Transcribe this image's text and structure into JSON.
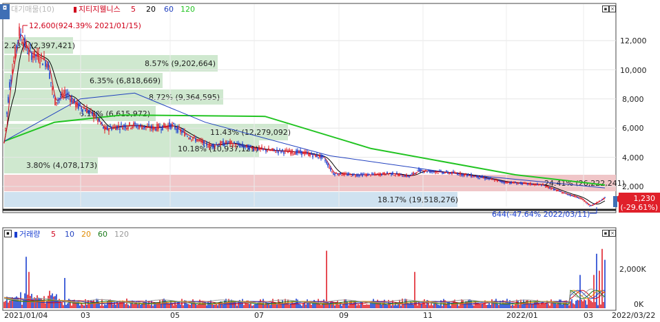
{
  "price_panel": {
    "legend": {
      "prefix": "▮",
      "name": "지티지웰니스",
      "ma_labels": [
        "5",
        "20",
        "60",
        "120"
      ],
      "ma_colors": [
        "#d0021b",
        "#000000",
        "#1f3fbf",
        "#22c422"
      ],
      "ghost_text": "대기매물(10)"
    },
    "y_ticks": [
      "12,000",
      "10,000",
      "8,000",
      "6,000",
      "4,000",
      "2,000"
    ],
    "current_price": "1,230",
    "current_change": "(-29.61%)",
    "high_annotation": "12,600(924.39% 2021/01/15)",
    "low_annotation": "644(-47.64% 2022/03/11)",
    "volume_profile": [
      {
        "label": "2.23%  (2,397,421)"
      },
      {
        "label": "8.57%  (9,202,664)"
      },
      {
        "label": "6.35%  (6,818,669)"
      },
      {
        "label": "8.72%  (9,364,595)"
      },
      {
        "label": "6.15%  (6,615,972)"
      },
      {
        "label": "11.43%  (12,279,092)"
      },
      {
        "label": "10.18%  (10,937,121)"
      },
      {
        "label": "3.80%  (4,078,173)"
      },
      {
        "label": "24.41%  (26,222,241)"
      },
      {
        "label": "18.17%  (19,518,276)"
      }
    ]
  },
  "volume_panel": {
    "legend": {
      "prefix": "▮",
      "name": "거래량",
      "ma_labels": [
        "5",
        "10",
        "20",
        "60",
        "120"
      ],
      "ma_colors": [
        "#d0021b",
        "#1f3fbf",
        "#e08a00",
        "#1a7a1a",
        "#999999"
      ]
    },
    "y_ticks": [
      "2,000K",
      "0K"
    ]
  },
  "x_axis": {
    "labels": [
      "2021/01/04",
      "03",
      "05",
      "07",
      "09",
      "11",
      "2022/01",
      "03",
      "2022/03/22"
    ]
  },
  "colors": {
    "up": "#e0202a",
    "down": "#1a3fd0",
    "profile_green": "#cfe8cf",
    "profile_red": "#f0c6c8",
    "profile_blue": "#cfe2f0",
    "price_tag_bg": "#e0202a"
  },
  "chart_data": {
    "type": "candlestick",
    "title": "지티지웰니스",
    "x_range": [
      "2021/01/04",
      "2022/03/22"
    ],
    "ylim": [
      644,
      12600
    ],
    "price_points": [
      {
        "date": "2021/01/04",
        "price": 5000
      },
      {
        "date": "2021/01/08",
        "price": 9000
      },
      {
        "date": "2021/01/15",
        "price": 12600
      },
      {
        "date": "2021/01/22",
        "price": 11200
      },
      {
        "date": "2021/01/29",
        "price": 10900
      },
      {
        "date": "2021/02/05",
        "price": 10500
      },
      {
        "date": "2021/02/10",
        "price": 7800
      },
      {
        "date": "2021/02/19",
        "price": 8400
      },
      {
        "date": "2021/02/26",
        "price": 7600
      },
      {
        "date": "2021/03/05",
        "price": 7300
      },
      {
        "date": "2021/03/12",
        "price": 6800
      },
      {
        "date": "2021/03/19",
        "price": 5900
      },
      {
        "date": "2021/03/26",
        "price": 6100
      },
      {
        "date": "2021/04/09",
        "price": 6200
      },
      {
        "date": "2021/04/23",
        "price": 6000
      },
      {
        "date": "2021/05/07",
        "price": 6200
      },
      {
        "date": "2021/05/21",
        "price": 5400
      },
      {
        "date": "2021/06/04",
        "price": 4800
      },
      {
        "date": "2021/06/18",
        "price": 5000
      },
      {
        "date": "2021/07/02",
        "price": 4700
      },
      {
        "date": "2021/07/16",
        "price": 4500
      },
      {
        "date": "2021/07/30",
        "price": 4400
      },
      {
        "date": "2021/08/13",
        "price": 4300
      },
      {
        "date": "2021/08/27",
        "price": 4000
      },
      {
        "date": "2021/09/03",
        "price": 2900
      },
      {
        "date": "2021/09/17",
        "price": 2800
      },
      {
        "date": "2021/10/01",
        "price": 2800
      },
      {
        "date": "2021/10/15",
        "price": 2900
      },
      {
        "date": "2021/10/29",
        "price": 2700
      },
      {
        "date": "2021/11/05",
        "price": 3100
      },
      {
        "date": "2021/11/19",
        "price": 3000
      },
      {
        "date": "2021/12/03",
        "price": 2900
      },
      {
        "date": "2021/12/17",
        "price": 2700
      },
      {
        "date": "2022/01/07",
        "price": 2300
      },
      {
        "date": "2022/01/21",
        "price": 2200
      },
      {
        "date": "2022/02/04",
        "price": 2100
      },
      {
        "date": "2022/02/18",
        "price": 1600
      },
      {
        "date": "2022/03/04",
        "price": 1200
      },
      {
        "date": "2022/03/11",
        "price": 644
      },
      {
        "date": "2022/03/22",
        "price": 1230
      }
    ],
    "ma120_points": [
      {
        "date": "2021/01/04",
        "price": 5100
      },
      {
        "date": "2021/02/10",
        "price": 6400
      },
      {
        "date": "2021/04/01",
        "price": 6900
      },
      {
        "date": "2021/07/15",
        "price": 6800
      },
      {
        "date": "2021/10/01",
        "price": 4600
      },
      {
        "date": "2022/01/15",
        "price": 2800
      },
      {
        "date": "2022/03/22",
        "price": 2100
      }
    ],
    "ma60_points": [
      {
        "date": "2021/01/04",
        "price": 5100
      },
      {
        "date": "2021/03/01",
        "price": 8000
      },
      {
        "date": "2021/04/10",
        "price": 8400
      },
      {
        "date": "2021/06/01",
        "price": 6400
      },
      {
        "date": "2021/09/01",
        "price": 4100
      },
      {
        "date": "2021/12/01",
        "price": 2900
      },
      {
        "date": "2022/03/22",
        "price": 1900
      }
    ]
  }
}
